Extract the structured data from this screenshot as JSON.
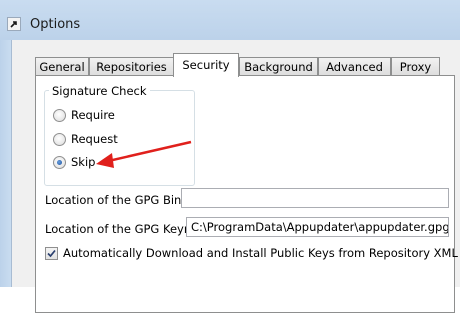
{
  "window": {
    "title": "Options",
    "app_icon": "shortcut-arrow-icon"
  },
  "tabs": [
    {
      "label": "General",
      "active": false
    },
    {
      "label": "Repositories",
      "active": false
    },
    {
      "label": "Security",
      "active": true
    },
    {
      "label": "Background",
      "active": false
    },
    {
      "label": "Advanced",
      "active": false
    },
    {
      "label": "Proxy",
      "active": false
    }
  ],
  "signature_check": {
    "title": "Signature Check",
    "options": [
      {
        "label": "Require",
        "selected": false
      },
      {
        "label": "Request",
        "selected": false
      },
      {
        "label": "Skip",
        "selected": true
      }
    ]
  },
  "gpg_binary": {
    "label": "Location of the GPG Binary:",
    "value": ""
  },
  "gpg_keyring": {
    "label": "Location of the GPG Keyring:",
    "value": "C:\\ProgramData\\Appupdater\\appupdater.gpg"
  },
  "auto_download": {
    "label": "Automatically Download and Install Public Keys from Repository XML File",
    "checked": true
  },
  "annotation": {
    "arrow_color": "#e0201c",
    "icon": "red-arrow-icon"
  }
}
